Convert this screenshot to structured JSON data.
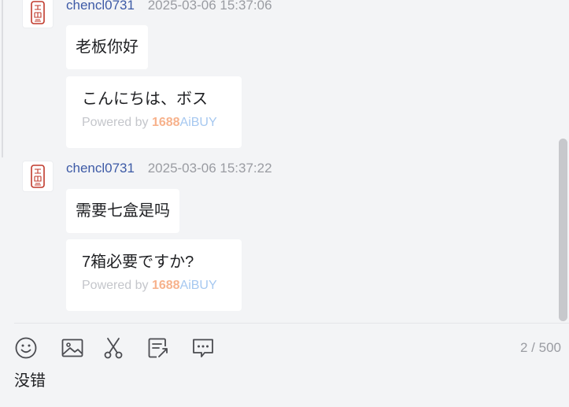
{
  "messages": [
    {
      "sender": "chencl0731",
      "time": "2025-03-06 15:37:06",
      "original": "老板你好",
      "translation": "こんにちは、ボス",
      "powered": {
        "prefix": "Powered by ",
        "brand_num": "1688",
        "brand_ai": "AiBUY"
      }
    },
    {
      "sender": "chencl0731",
      "time": "2025-03-06 15:37:22",
      "original": "需要七盒是吗",
      "translation": "7箱必要ですか?",
      "powered": {
        "prefix": "Powered by ",
        "brand_num": "1688",
        "brand_ai": "AiBUY"
      }
    }
  ],
  "toolbar": {
    "icons": [
      "emoji-icon",
      "image-icon",
      "scissors-icon",
      "note-icon",
      "chat-icon"
    ],
    "counter": {
      "current": "2",
      "separator": " / ",
      "max": "500"
    }
  },
  "input": {
    "value": "没错"
  },
  "colors": {
    "sender": "#3d5aa6",
    "timestamp": "#9a9ca2",
    "brand_num": "#f7b28c",
    "brand_ai": "#a6c8f0"
  }
}
